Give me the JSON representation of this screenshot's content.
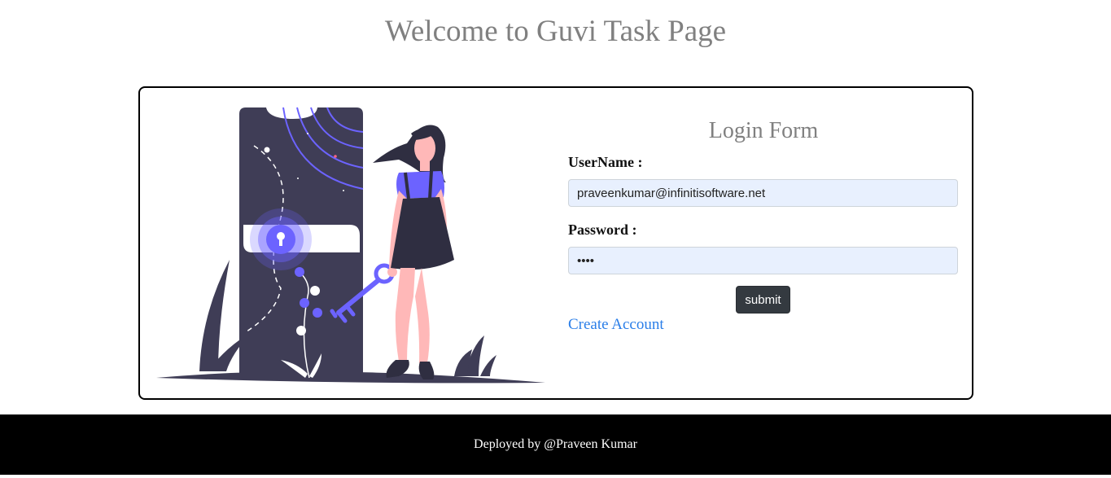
{
  "header": {
    "title": "Welcome to Guvi Task Page"
  },
  "login_form": {
    "title": "Login Form",
    "username_label": "UserName :",
    "username_value": "praveenkumar@infinitisoftware.net",
    "password_label": "Password :",
    "password_value": "1234",
    "submit_label": "submit",
    "create_account_label": "Create Account"
  },
  "footer": {
    "text": "Deployed by @Praveen Kumar"
  },
  "colors": {
    "accent_purple": "#6c63ff",
    "dark_navy": "#3f3d56",
    "button_dark": "#343a40",
    "link_blue": "#2a7ee8",
    "input_autofill_bg": "#e8f0fe"
  },
  "illustration": {
    "icon": "phone-lock-key-woman-illustration"
  }
}
